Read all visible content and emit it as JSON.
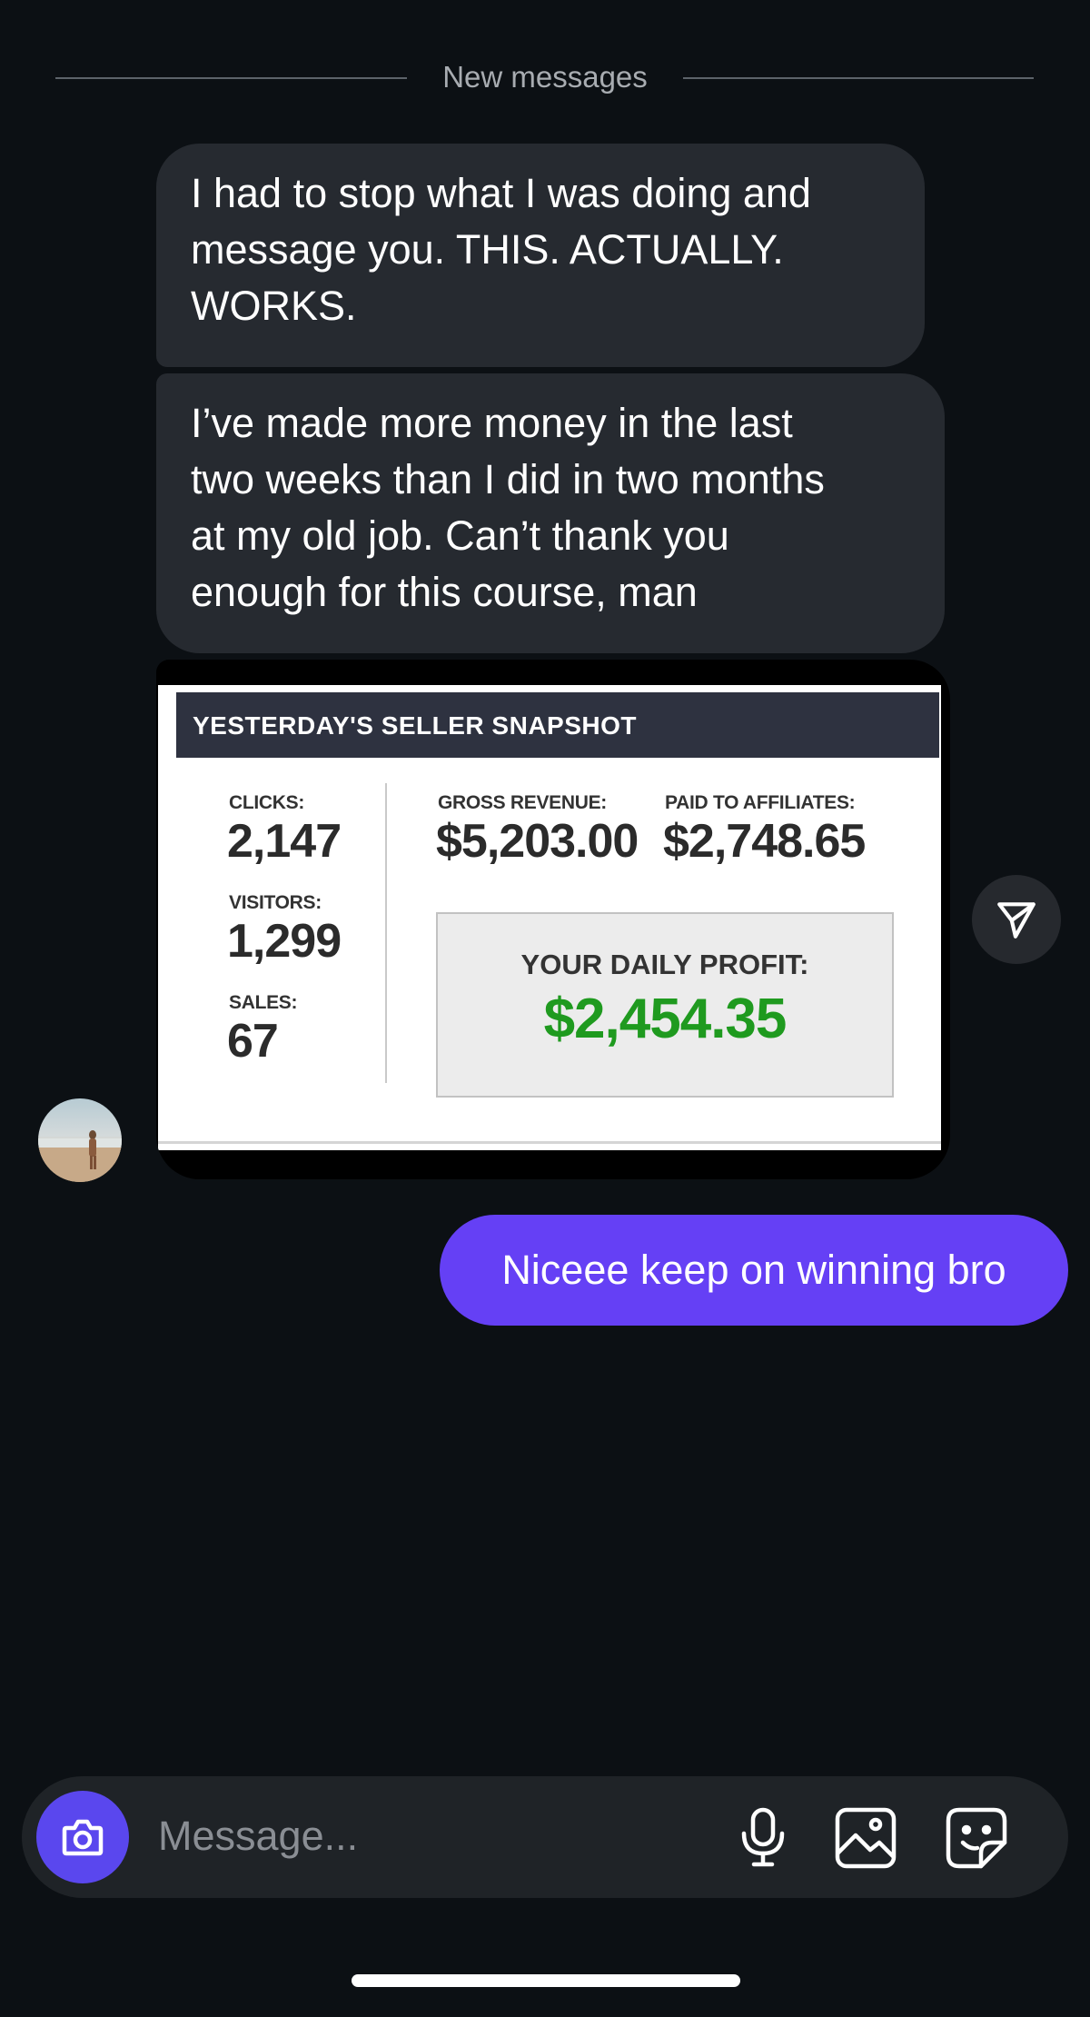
{
  "divider": {
    "label": "New messages"
  },
  "messages": [
    {
      "lines": [
        "I had to stop what I was doing and",
        "message you. THIS. ACTUALLY.",
        "WORKS."
      ]
    },
    {
      "lines": [
        "I’ve made more money in the last",
        "two weeks than I did in two months",
        "at my old job. Can’t thank you",
        "enough for this course, man"
      ]
    }
  ],
  "snapshot": {
    "title": "YESTERDAY'S SELLER SNAPSHOT",
    "clicks_label": "CLICKS:",
    "clicks": "2,147",
    "visitors_label": "VISITORS:",
    "visitors": "1,299",
    "sales_label": "SALES:",
    "sales": "67",
    "gross_label": "GROSS REVENUE:",
    "gross": "$5,203.00",
    "paid_label": "PAID TO AFFILIATES:",
    "paid": "$2,748.65",
    "profit_label": "YOUR DAILY PROFIT:",
    "profit": "$2,454.35"
  },
  "sent_message": "Niceee keep on winning bro",
  "composer": {
    "placeholder": "Message..."
  },
  "icons": {
    "share": "share-icon",
    "avatar": "avatar",
    "camera": "camera-icon",
    "mic": "microphone-icon",
    "gallery": "gallery-icon",
    "sticker": "sticker-icon"
  },
  "colors": {
    "background": "#0c1014",
    "received_bubble": "#262a30",
    "sent_bubble": "#6540f5",
    "profit_green": "#1f9a1f"
  }
}
